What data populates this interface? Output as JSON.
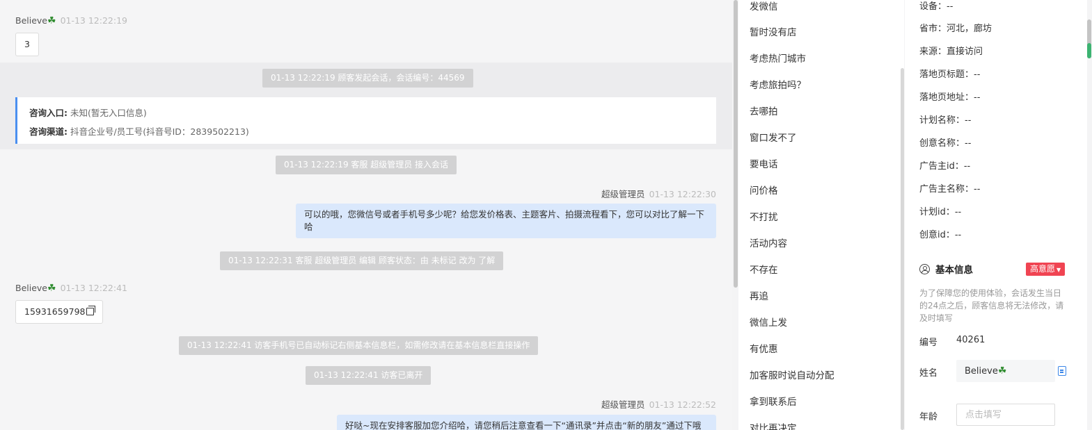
{
  "chat": {
    "msg1": {
      "sender": "Believe",
      "emoji": "☘",
      "time": "01-13 12:22:19",
      "text": "3"
    },
    "sys1": "01-13 12:22:19 顾客发起会话，会话编号：44569",
    "entry": {
      "label1": "咨询入口:",
      "value1": "未知(暂无入口信息)",
      "label2": "咨询渠道:",
      "value2": "抖音企业号/员工号(抖音号ID：2839502213)"
    },
    "sys2": "01-13 12:22:19 客服 超级管理员 接入会话",
    "msg2": {
      "sender": "超级管理员",
      "time": "01-13 12:22:30",
      "text": "可以的哦，您微信号或者手机号多少呢？给您发价格表、主题客片、拍摄流程看下，您可以对比了解一下哈"
    },
    "sys3": "01-13 12:22:31 客服 超级管理员 编辑 顾客状态：由 未标记 改为 了解",
    "msg3": {
      "sender": "Believe",
      "emoji": "☘",
      "time": "01-13 12:22:41",
      "text": "15931659798"
    },
    "sys4": "01-13 12:22:41 访客手机号已自动标记右侧基本信息栏，如需修改请在基本信息栏直接操作",
    "sys5": "01-13 12:22:41 访客已离开",
    "msg4": {
      "sender": "超级管理员",
      "time": "01-13 12:22:52",
      "text": "好哒~现在安排客服加您介绍哈，请您稍后注意查看一下“通讯录”并点击“新的朋友”通过下哦"
    }
  },
  "quick_replies": [
    "发微信",
    "暂时没有店",
    "考虑热门城市",
    "考虑旅拍吗？",
    "去哪拍",
    "窗口发不了",
    "要电话",
    "问价格",
    "不打扰",
    "活动内容",
    "不存在",
    "再追",
    "微信上发",
    "有优惠",
    "加客服时说自动分配",
    "拿到联系后",
    "对比再决定"
  ],
  "visitor_info": [
    "设备：--",
    "省市：河北，廊坊",
    "来源：直接访问",
    "落地页标题：--",
    "落地页地址：--",
    "计划名称：--",
    "创意名称：--",
    "广告主id：--",
    "广告主名称：--",
    "计划id：--",
    "创意id：--"
  ],
  "basic_info": {
    "title": "基本信息",
    "intent_badge": "高意愿",
    "notice": "为了保障您的使用体验，会话发生当日的24点之后，顾客信息将无法修改，请及时填写",
    "id_label": "编号",
    "id_value": "40261",
    "name_label": "姓名",
    "name_value": "Believe",
    "name_emoji": "☘",
    "age_label": "年龄",
    "age_placeholder": "点击填写"
  },
  "colors": {
    "accent": "#4a8ff0",
    "badge": "#f04452",
    "outgoing_bubble": "#dae8fc",
    "system_pill": "#d2d2d3"
  }
}
